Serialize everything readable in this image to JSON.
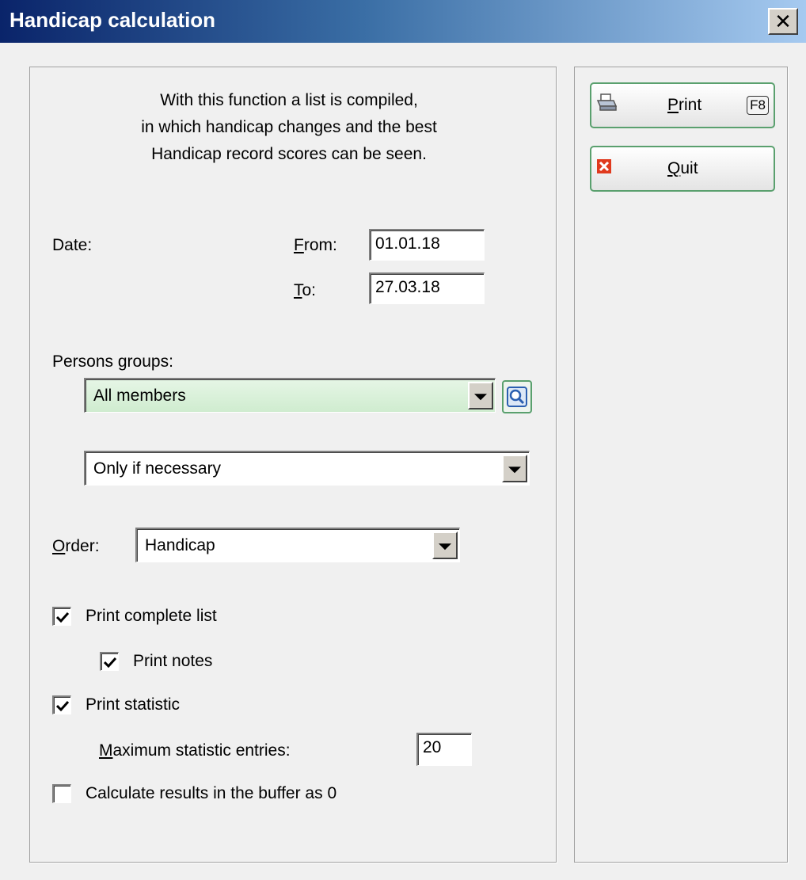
{
  "window": {
    "title": "Handicap calculation",
    "close_glyph": "✕"
  },
  "intro": {
    "line1": "With this function a list is compiled,",
    "line2": "in which handicap changes and the best",
    "line3": "Handicap record scores can be seen."
  },
  "date": {
    "label": "Date:",
    "from_key": "F",
    "from_rest": "rom:",
    "from_value": "01.01.18",
    "to_key": "T",
    "to_rest": "o:",
    "to_value": "27.03.18"
  },
  "persons_groups": {
    "label": "Persons groups:",
    "group_value": "All members",
    "mode_value": "Only if necessary"
  },
  "order": {
    "key": "O",
    "rest": "rder:",
    "value": "Handicap"
  },
  "options": {
    "print_complete_list": {
      "label": "Print complete list",
      "checked": true
    },
    "print_notes": {
      "label": "Print notes",
      "checked": true
    },
    "print_statistic": {
      "label": "Print statistic",
      "checked": true
    },
    "max_entries": {
      "key": "M",
      "rest": "aximum statistic entries:",
      "value": "20"
    },
    "calc_buffer": {
      "label": "Calculate results in the buffer as 0",
      "checked": false
    }
  },
  "buttons": {
    "print": {
      "key": "P",
      "rest": "rint",
      "shortcut": "F8",
      "icon": "printer-icon"
    },
    "quit": {
      "key": "Q",
      "rest": "uit",
      "icon": "close-icon"
    }
  },
  "colors": {
    "accent_green": "#5aa06e",
    "title_blue": "#0a246a",
    "quit_red": "#e03a1e"
  }
}
